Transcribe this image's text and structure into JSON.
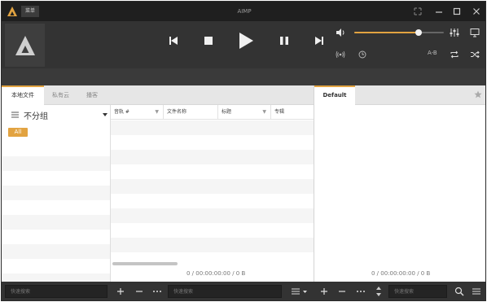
{
  "window": {
    "title": "AIMP",
    "menu_label": "菜单"
  },
  "colors": {
    "accent": "#e2a341",
    "titlebar_bg": "#1f1f1f",
    "player_bg": "#333333"
  },
  "player": {
    "volume_percent": 72,
    "ab_label": "A-B",
    "icons": [
      "previous-icon",
      "stop-icon",
      "play-icon",
      "pause-icon",
      "next-icon",
      "volume-icon",
      "equalizer-icon",
      "visualization-icon",
      "radio-icon",
      "timer-icon",
      "repeat-icon",
      "shuffle-icon"
    ]
  },
  "tabs": [
    {
      "label": "本地文件",
      "active": true
    },
    {
      "label": "私有云",
      "active": false
    },
    {
      "label": "播客",
      "active": false
    }
  ],
  "playlist_tab": {
    "label": "Default"
  },
  "group_panel": {
    "grouping_label": "不分组",
    "all_label": "All"
  },
  "table": {
    "columns": [
      {
        "label": "音轨 #",
        "filter": "▼"
      },
      {
        "label": "文件名称",
        "filter": ""
      },
      {
        "label": "标题",
        "filter": "▼"
      },
      {
        "label": "专辑",
        "filter": ""
      }
    ],
    "rows": []
  },
  "status": {
    "library": "0 / 00:00:00:00 / 0 B",
    "playlist": "0 / 00:00:00:00 / 0 B"
  },
  "bottombar": {
    "search_placeholder_1": "快速搜索",
    "search_placeholder_2": "快速搜索",
    "search_placeholder_3": "快速搜索"
  }
}
